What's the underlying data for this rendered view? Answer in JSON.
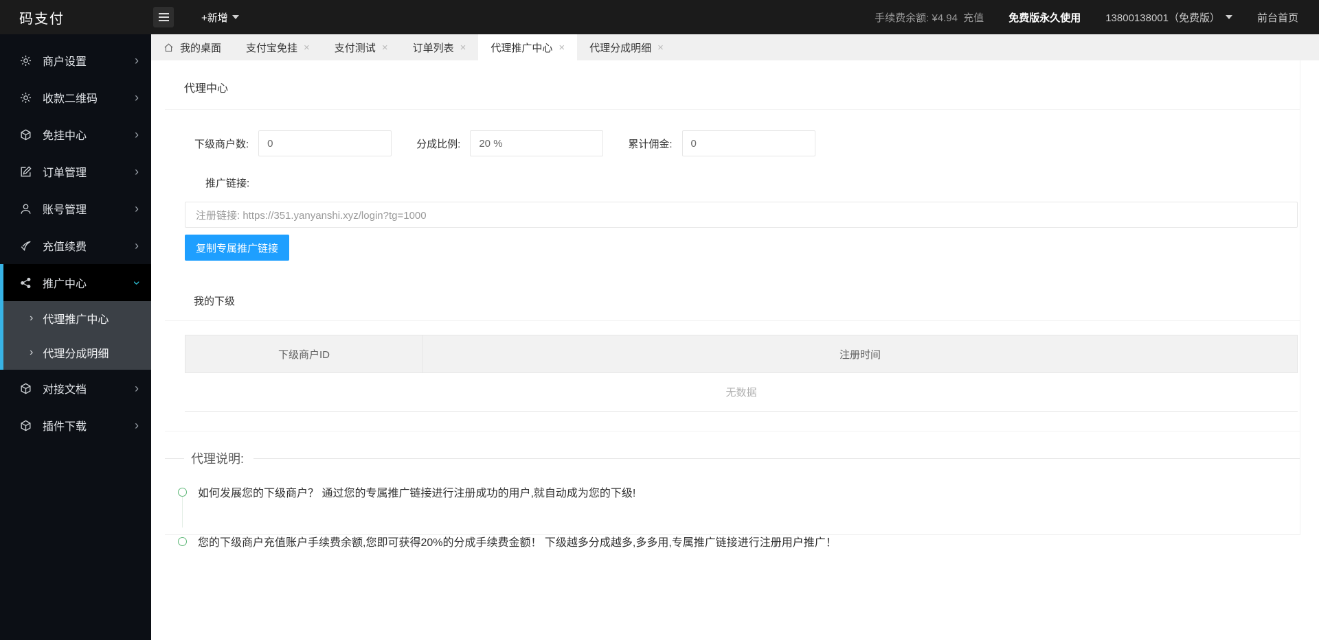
{
  "topbar": {
    "logo": "码支付",
    "new_button": "+新增",
    "fee_balance_label": "手续费余额:",
    "fee_balance_amount": "¥4.94",
    "recharge_label": "充值",
    "license": "免费版永久使用",
    "account": "13800138001（免费版）",
    "front_home": "前台首页"
  },
  "sidebar": {
    "items": [
      {
        "label": "商户设置",
        "icon": "gear-icon"
      },
      {
        "label": "收款二维码",
        "icon": "gear-icon"
      },
      {
        "label": "免挂中心",
        "icon": "cube-icon"
      },
      {
        "label": "订单管理",
        "icon": "edit-icon"
      },
      {
        "label": "账号管理",
        "icon": "user-icon"
      },
      {
        "label": "充值续费",
        "icon": "check-icon"
      },
      {
        "label": "推广中心",
        "icon": "share-icon",
        "active": true,
        "expanded": true
      },
      {
        "label": "对接文档",
        "icon": "cube-icon"
      },
      {
        "label": "插件下载",
        "icon": "cube-icon"
      }
    ],
    "subitems": [
      {
        "label": "代理推广中心",
        "active": true
      },
      {
        "label": "代理分成明细"
      }
    ]
  },
  "tabs": [
    {
      "label": "我的桌面",
      "closable": false
    },
    {
      "label": "支付宝免挂",
      "closable": true
    },
    {
      "label": "支付测试",
      "closable": true
    },
    {
      "label": "订单列表",
      "closable": true
    },
    {
      "label": "代理推广中心",
      "closable": true,
      "active": true
    },
    {
      "label": "代理分成明细",
      "closable": true
    }
  ],
  "agent_center": {
    "title": "代理中心",
    "fields": [
      {
        "label": "下级商户数:",
        "value": "0"
      },
      {
        "label": "分成比例:",
        "value": "20 %"
      },
      {
        "label": "累计佣金:",
        "value": "0"
      }
    ],
    "promo_link_label": "推广链接:",
    "register_link": "注册链接: https://351.yanyanshi.xyz/login?tg=1000",
    "copy_button": "复制专属推广链接"
  },
  "subordinates": {
    "title": "我的下级",
    "columns": [
      "下级商户ID",
      "注册时间"
    ],
    "empty_text": "无数据"
  },
  "agent_notes": {
    "title": "代理说明:",
    "notes": [
      "如何发展您的下级商户？ 通过您的专属推广链接进行注册成功的用户,就自动成为您的下级!",
      "您的下级商户充值账户手续费余额,您即可获得20%的分成手续费金额！ 下级越多分成越多,多多用,专属推广链接进行注册用户推广！"
    ]
  },
  "colors": {
    "topbar_bg": "#1b1b1b",
    "sidebar_bg": "#0c0f15",
    "sidebar_active_bar": "#38b3e5",
    "submenu_bg": "#3b4046",
    "tabbar_bg": "#f0f0f0",
    "accent_blue": "#1E9FFF",
    "note_green": "#5FB878"
  }
}
